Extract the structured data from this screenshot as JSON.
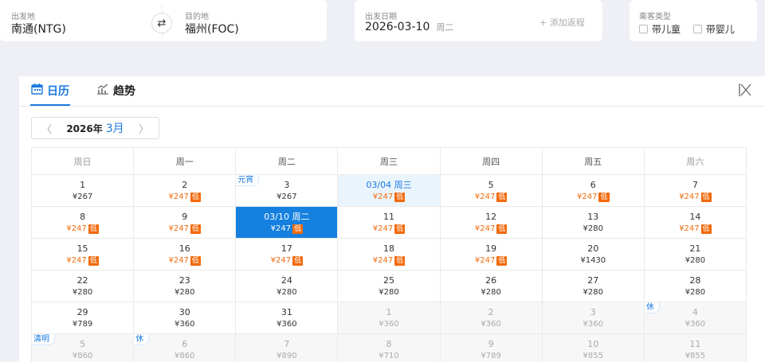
{
  "search": {
    "from_label": "出发地",
    "from_value": "南通(NTG)",
    "to_label": "目的地",
    "to_value": "福州(FOC)",
    "date_label": "出发日期",
    "date_value": "2026-03-10",
    "date_weekday": "周二",
    "add_return": "+ 添加返程",
    "pax_label": "乘客类型",
    "child_label": "带儿童",
    "infant_label": "带婴儿"
  },
  "tabs": {
    "calendar": "日历",
    "trend": "趋势"
  },
  "nav": {
    "year": "2026年",
    "month": "3月"
  },
  "weekdays": [
    "周日",
    "周一",
    "周二",
    "周三",
    "周四",
    "周五",
    "周六"
  ],
  "low_tag": "低",
  "weeks": [
    [
      {
        "day": "1",
        "price": "¥267"
      },
      {
        "day": "2",
        "price": "¥247",
        "low": true
      },
      {
        "day": "3",
        "price": "¥267",
        "holiday": "元宵"
      },
      {
        "day": "03/04 周三",
        "price": "¥247",
        "low": true,
        "state": "hl"
      },
      {
        "day": "5",
        "price": "¥247",
        "low": true
      },
      {
        "day": "6",
        "price": "¥247",
        "low": true
      },
      {
        "day": "7",
        "price": "¥247",
        "low": true
      }
    ],
    [
      {
        "day": "8",
        "price": "¥247",
        "low": true
      },
      {
        "day": "9",
        "price": "¥247",
        "low": true
      },
      {
        "day": "03/10 周二",
        "price": "¥247",
        "low": true,
        "state": "sel"
      },
      {
        "day": "11",
        "price": "¥247",
        "low": true
      },
      {
        "day": "12",
        "price": "¥247",
        "low": true
      },
      {
        "day": "13",
        "price": "¥280"
      },
      {
        "day": "14",
        "price": "¥247",
        "low": true
      }
    ],
    [
      {
        "day": "15",
        "price": "¥247",
        "low": true
      },
      {
        "day": "16",
        "price": "¥247",
        "low": true
      },
      {
        "day": "17",
        "price": "¥247",
        "low": true
      },
      {
        "day": "18",
        "price": "¥247",
        "low": true
      },
      {
        "day": "19",
        "price": "¥247",
        "low": true
      },
      {
        "day": "20",
        "price": "¥1430"
      },
      {
        "day": "21",
        "price": "¥280"
      }
    ],
    [
      {
        "day": "22",
        "price": "¥280"
      },
      {
        "day": "23",
        "price": "¥280"
      },
      {
        "day": "24",
        "price": "¥280"
      },
      {
        "day": "25",
        "price": "¥280"
      },
      {
        "day": "26",
        "price": "¥280"
      },
      {
        "day": "27",
        "price": "¥280"
      },
      {
        "day": "28",
        "price": "¥280"
      }
    ],
    [
      {
        "day": "29",
        "price": "¥789"
      },
      {
        "day": "30",
        "price": "¥360"
      },
      {
        "day": "31",
        "price": "¥360"
      },
      {
        "day": "1",
        "price": "¥360",
        "state": "other"
      },
      {
        "day": "2",
        "price": "¥360",
        "state": "other"
      },
      {
        "day": "3",
        "price": "¥360",
        "state": "other"
      },
      {
        "day": "4",
        "price": "¥360",
        "state": "other",
        "holiday": "休"
      }
    ],
    [
      {
        "day": "5",
        "price": "¥860",
        "state": "other",
        "holiday": "清明"
      },
      {
        "day": "6",
        "price": "¥860",
        "state": "other",
        "holiday": "休"
      },
      {
        "day": "7",
        "price": "¥890",
        "state": "other"
      },
      {
        "day": "8",
        "price": "¥710",
        "state": "other"
      },
      {
        "day": "9",
        "price": "¥789",
        "state": "other"
      },
      {
        "day": "10",
        "price": "¥855",
        "state": "other"
      },
      {
        "day": "11",
        "price": "¥855",
        "state": "other"
      }
    ]
  ]
}
